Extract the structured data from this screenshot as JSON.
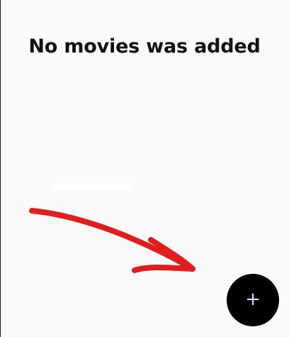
{
  "screen": {
    "empty_message": "No movies was added",
    "background_color": "#fafafa"
  },
  "fab": {
    "icon": "plus-icon",
    "glyph": "+",
    "background_color": "#000000",
    "icon_color": "#cfe0ff"
  },
  "annotation": {
    "icon": "red-arrow-annotation-icon",
    "color": "#e01e1e"
  }
}
